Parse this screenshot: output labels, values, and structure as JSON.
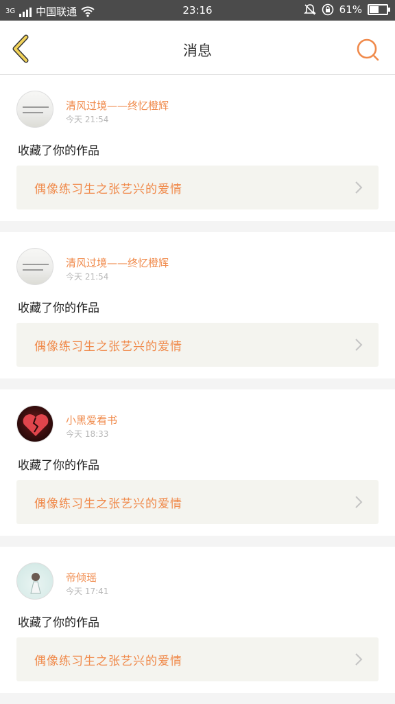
{
  "status_bar": {
    "network": "3G",
    "carrier": "中国联通",
    "time": "23:16",
    "battery": "61%",
    "battery_level": 0.61,
    "icons": [
      "signal-icon",
      "wifi-icon",
      "mute-icon",
      "rotation-lock-icon",
      "battery-icon"
    ]
  },
  "header": {
    "title": "消息",
    "back_icon": "chevron-left-icon",
    "search_icon": "search-icon",
    "accent": "#f08a4b",
    "back_color": "#f2d35a"
  },
  "notifications": [
    {
      "username": "清风过境——终忆橙辉",
      "time": "今天 21:54",
      "action": "收藏了你的作品",
      "work_title": "偶像练习生之张艺兴的爱情",
      "avatar": "paper-note-avatar"
    },
    {
      "username": "清风过境——终忆橙辉",
      "time": "今天 21:54",
      "action": "收藏了你的作品",
      "work_title": "偶像练习生之张艺兴的爱情",
      "avatar": "paper-note-avatar"
    },
    {
      "username": "小黑爱看书",
      "time": "今天 18:33",
      "action": "收藏了你的作品",
      "work_title": "偶像练习生之张艺兴的爱情",
      "avatar": "broken-heart-avatar"
    },
    {
      "username": "帝倾瑶",
      "time": "今天 17:41",
      "action": "收藏了你的作品",
      "work_title": "偶像练习生之张艺兴的爱情",
      "avatar": "girl-avatar"
    }
  ]
}
